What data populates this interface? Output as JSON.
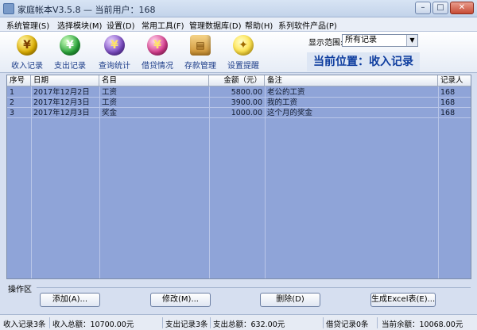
{
  "window": {
    "title": "家庭帐本V3.5.8 — 当前用户：168",
    "min_glyph": "–",
    "max_glyph": "□",
    "close_glyph": "✕"
  },
  "menu": [
    "系统管理(S)",
    "选择模块(M)",
    "设置(D)",
    "常用工具(F)",
    "管理数据库(D)",
    "帮助(H)",
    "系列软件产品(P)"
  ],
  "toolbar": {
    "income": {
      "label": "收入记录",
      "glyph": "¥",
      "icon": "income-coin-icon"
    },
    "expense": {
      "label": "支出记录",
      "glyph": "¥",
      "icon": "expense-coin-icon"
    },
    "stats": {
      "label": "查询统计",
      "glyph": "¥",
      "icon": "stats-coin-icon"
    },
    "loan": {
      "label": "借贷情况",
      "glyph": "¥",
      "icon": "loan-coin-icon"
    },
    "deposit": {
      "label": "存款管理",
      "glyph": "▤",
      "icon": "deposit-card-icon"
    },
    "reminder": {
      "label": "设置提醒",
      "glyph": "✦",
      "icon": "lightbulb-icon"
    }
  },
  "scope": {
    "label": "显示范围:",
    "value": "所有记录"
  },
  "location": "当前位置：收入记录",
  "table": {
    "headers": [
      "序号",
      "日期",
      "名目",
      "金额（元）",
      "备注",
      "记录人"
    ],
    "rows": [
      [
        "1",
        "2017年12月2日",
        "工资",
        "5800.00",
        "老公的工资",
        "168"
      ],
      [
        "2",
        "2017年12月3日",
        "工资",
        "3900.00",
        "我的工资",
        "168"
      ],
      [
        "3",
        "2017年12月3日",
        "奖金",
        "1000.00",
        "这个月的奖金",
        "168"
      ]
    ]
  },
  "operations": {
    "label": "操作区",
    "add": "添加(A)...",
    "edit": "修改(M)...",
    "delete": "删除(D)",
    "excel": "生成Excel表(E)..."
  },
  "status": {
    "income_count": "收入记录3条",
    "income_total": "收入总额：10700.00元",
    "expense_count": "支出记录3条",
    "expense_total": "支出总额：632.00元",
    "loan_count": "借贷记录0条",
    "balance": "当前余额：10068.00元"
  },
  "colors": {
    "grid_bg": "#8fa4d8",
    "location_text": "#0d3c9e"
  }
}
